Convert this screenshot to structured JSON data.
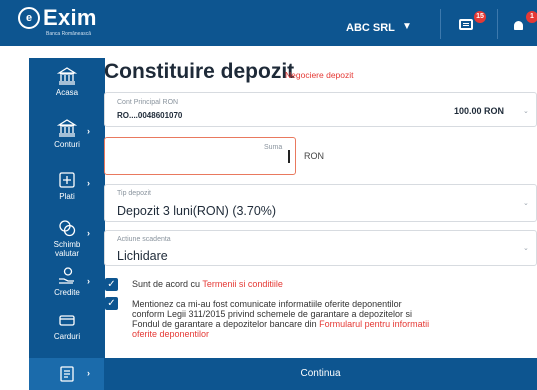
{
  "header": {
    "logo_text": "Exim",
    "logo_sub": "Banca Românească",
    "company": "ABC SRL",
    "messages_count": "15",
    "notifications_count": "1"
  },
  "sidebar": {
    "items": [
      {
        "label": "Acasa",
        "icon": "bank-icon"
      },
      {
        "label": "Conturi",
        "icon": "bank-icon"
      },
      {
        "label": "Plati",
        "icon": "payments-icon"
      },
      {
        "label": "Schimb valutar",
        "label_l1": "Schimb",
        "label_l2": "valutar",
        "icon": "currency-exchange-icon"
      },
      {
        "label": "Credite",
        "icon": "credit-hand-icon"
      },
      {
        "label": "Carduri",
        "icon": "card-icon"
      },
      {
        "label": "",
        "icon": "deposit-icon"
      }
    ]
  },
  "main": {
    "title": "Constituire depozit",
    "title_link": "Negociere depozit",
    "account": {
      "label": "Cont Principal RON",
      "value": "RO....0048601070",
      "balance": "100.00 RON"
    },
    "amount": {
      "label": "Suma",
      "value": "",
      "currency": "RON"
    },
    "deposit_type": {
      "label": "Tip depozit",
      "value": "Depozit 3 luni(RON) (3.70%)"
    },
    "maturity_action": {
      "label": "Actiune scadenta",
      "value": "Lichidare"
    },
    "consent1": {
      "prefix": "Sunt de acord cu ",
      "link": "Termenii si conditiile"
    },
    "consent2": {
      "line1": "Mentionez ca mi-au fost comunicate informatiile oferite deponentilor",
      "line2": "conform Legii 311/2015 privind schemele de garantare a depozitelor si",
      "line3_prefix": "Fondul de garantare a depozitelor bancare din ",
      "line3_link": "Formularul pentru informatii",
      "line4_link": "oferite deponentilor"
    },
    "continue_label": "Continua"
  },
  "colors": {
    "primary": "#0d5590",
    "accent": "#e53935",
    "input_active_border": "#e9795e"
  }
}
